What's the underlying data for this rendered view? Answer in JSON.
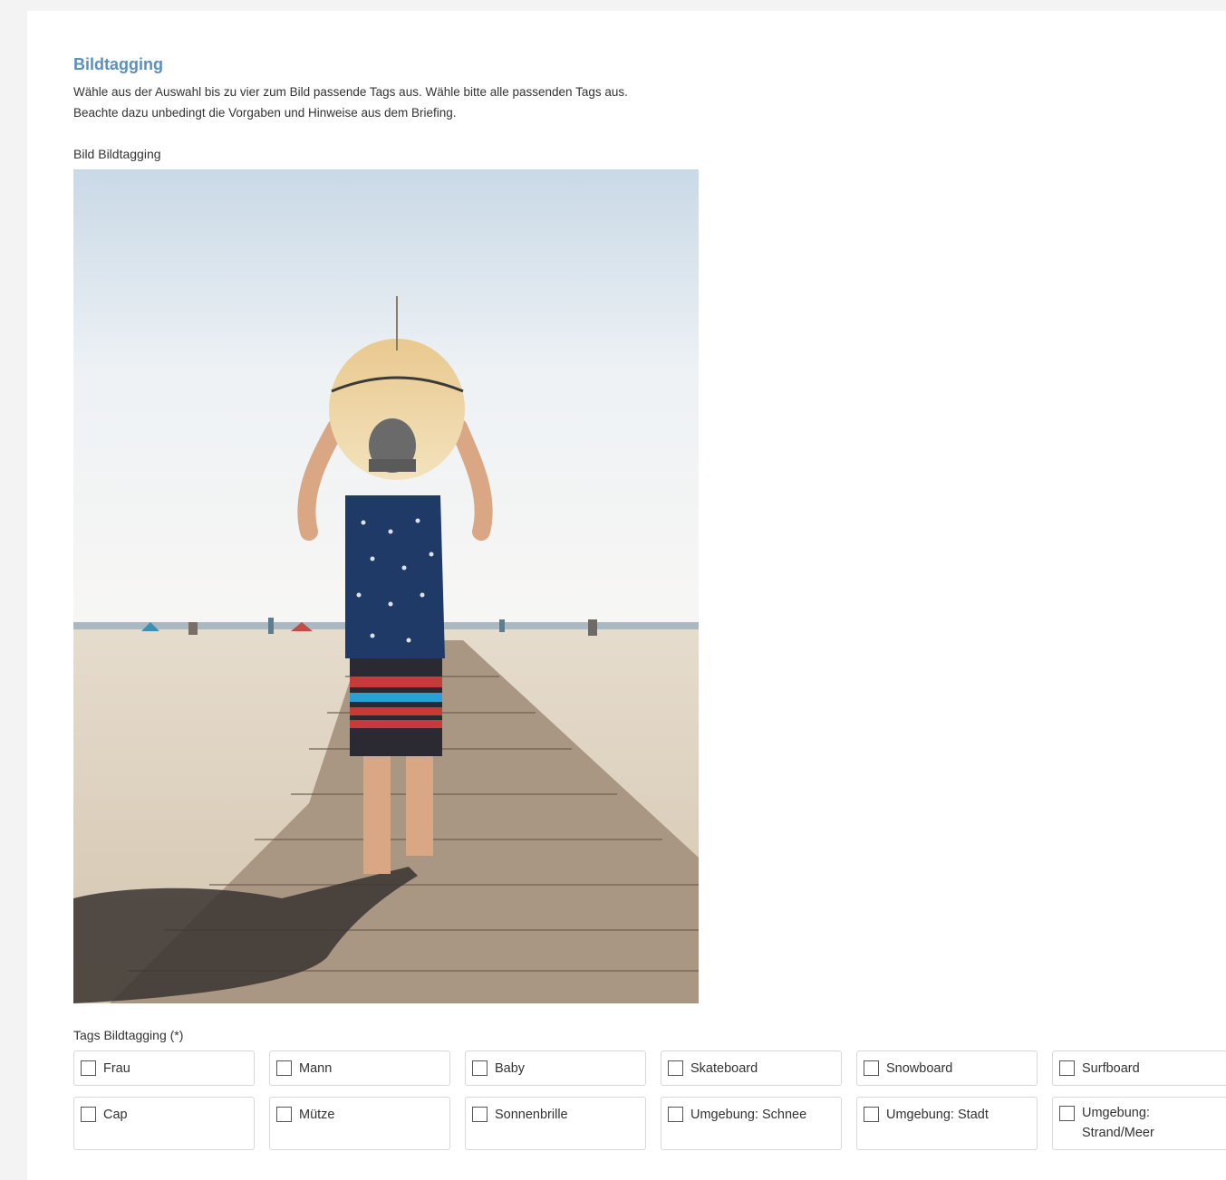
{
  "task": {
    "title": "Bildtagging",
    "instructions": [
      "Wähle aus der Auswahl bis zu vier zum Bild passende Tags aus. Wähle bitte alle passenden Tags aus.",
      "Beachte dazu unbedingt die Vorgaben und Hinweise aus dem Briefing."
    ]
  },
  "image_field": {
    "label": "Bild Bildtagging"
  },
  "tags_field": {
    "label": "Tags Bildtagging (*)",
    "options": [
      {
        "label": "Frau",
        "checked": false
      },
      {
        "label": "Mann",
        "checked": false
      },
      {
        "label": "Baby",
        "checked": false
      },
      {
        "label": "Skateboard",
        "checked": false
      },
      {
        "label": "Snowboard",
        "checked": false
      },
      {
        "label": "Surfboard",
        "checked": false
      },
      {
        "label": "Cap",
        "checked": false
      },
      {
        "label": "Mütze",
        "checked": false
      },
      {
        "label": "Sonnenbrille",
        "checked": false
      },
      {
        "label": "Umgebung: Schnee",
        "checked": false
      },
      {
        "label": "Umgebung: Stadt",
        "checked": false
      },
      {
        "label": "Umgebung: Strand/Meer",
        "checked": false
      }
    ]
  },
  "colors": {
    "title": "#5a8fbf",
    "text": "#333333",
    "background": "#f3f3f3",
    "panel": "#ffffff"
  }
}
